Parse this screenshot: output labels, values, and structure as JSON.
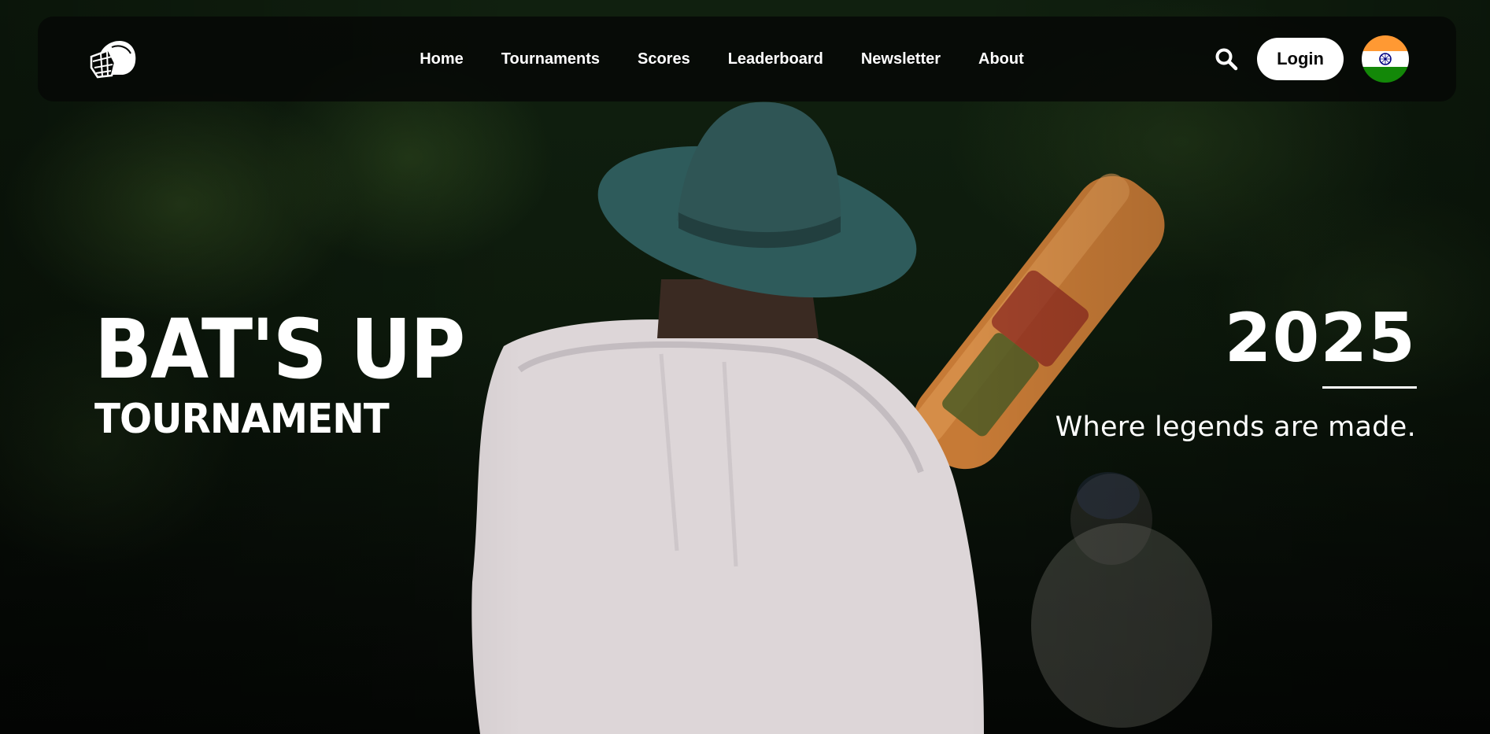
{
  "nav": {
    "items": [
      {
        "label": "Home"
      },
      {
        "label": "Tournaments"
      },
      {
        "label": "Scores"
      },
      {
        "label": "Leaderboard"
      },
      {
        "label": "Newsletter"
      },
      {
        "label": "About"
      }
    ],
    "login_label": "Login",
    "logo_icon": "cricket-helmet-icon",
    "search_icon": "search-icon",
    "language_flag": "india-flag-icon"
  },
  "hero": {
    "title": "BAT'S UP",
    "subtitle": "TOURNAMENT",
    "year": "2025",
    "tagline": "Where legends are made."
  },
  "colors": {
    "navbar_bg": "#060806",
    "text": "#ffffff",
    "button_bg": "#ffffff",
    "button_text": "#0a0a0a",
    "flag_saffron": "#ff9933",
    "flag_white": "#ffffff",
    "flag_green": "#138808",
    "flag_chakra": "#000080"
  }
}
